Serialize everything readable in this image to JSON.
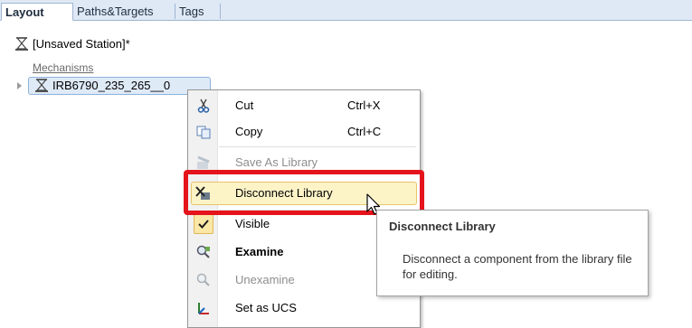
{
  "tabs": [
    {
      "label": "Layout",
      "active": true
    },
    {
      "label": "Paths&Targets",
      "active": false
    },
    {
      "label": "Tags",
      "active": false
    }
  ],
  "tree": {
    "station_label": "[Unsaved Station]*",
    "mechanisms_label": "Mechanisms",
    "selected_node_label": "IRB6790_235_265__0"
  },
  "context_menu": {
    "items": [
      {
        "label": "Cut",
        "shortcut": "Ctrl+X",
        "icon": "scissors-icon",
        "enabled": true
      },
      {
        "label": "Copy",
        "shortcut": "Ctrl+C",
        "icon": "copy-icon",
        "enabled": true
      },
      {
        "label": "Save As Library",
        "shortcut": "",
        "icon": "save-library-icon",
        "enabled": false
      },
      {
        "label": "Disconnect Library",
        "shortcut": "",
        "icon": "disconnect-library-icon",
        "enabled": true,
        "highlighted": true
      },
      {
        "label": "Visible",
        "shortcut": "",
        "icon": "checkmark-icon",
        "enabled": true,
        "checked": true
      },
      {
        "label": "Examine",
        "shortcut": "",
        "icon": "examine-icon",
        "enabled": true,
        "bold": true
      },
      {
        "label": "Unexamine",
        "shortcut": "",
        "icon": "unexamine-icon",
        "enabled": false
      },
      {
        "label": "Set as UCS",
        "shortcut": "",
        "icon": "ucs-icon",
        "enabled": true
      }
    ]
  },
  "tooltip": {
    "title": "Disconnect Library",
    "body": "Disconnect a component from the library file for editing."
  },
  "colors": {
    "highlight_border": "#e5131b",
    "menu_hover": "#fcf3c7",
    "tab_bar": "#dfe9f5"
  }
}
